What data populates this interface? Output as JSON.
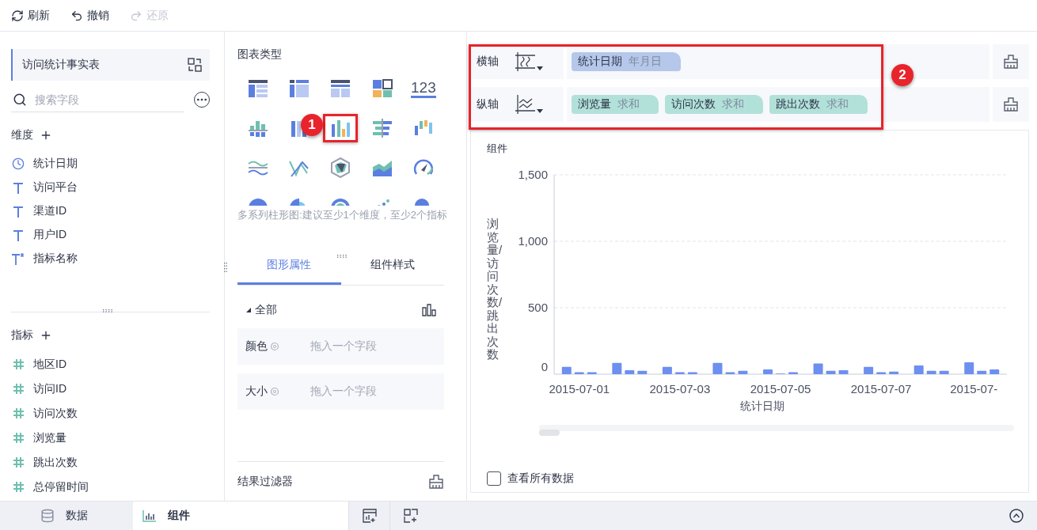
{
  "toolbar": {
    "buttons": [
      {
        "kind": "refresh",
        "label": "刷新",
        "disabled": false
      },
      {
        "kind": "undo",
        "label": "撤销",
        "disabled": false
      },
      {
        "kind": "redo",
        "label": "还原",
        "disabled": true
      }
    ]
  },
  "data_panel": {
    "table_name": "访问统计事实表",
    "search": {
      "placeholder": "搜索字段"
    },
    "dimensions": {
      "title": "维度",
      "fields": [
        {
          "kind": "date",
          "name": "统计日期"
        },
        {
          "kind": "text",
          "name": "访问平台"
        },
        {
          "kind": "text",
          "name": "渠道ID"
        },
        {
          "kind": "text",
          "name": "用户ID"
        },
        {
          "kind": "calc-text",
          "name": "指标名称"
        }
      ]
    },
    "measures": {
      "title": "指标",
      "fields": [
        {
          "kind": "number",
          "name": "地区ID"
        },
        {
          "kind": "number",
          "name": "访问ID"
        },
        {
          "kind": "number",
          "name": "访问次数"
        },
        {
          "kind": "number",
          "name": "浏览量"
        },
        {
          "kind": "number",
          "name": "跳出次数"
        },
        {
          "kind": "number",
          "name": "总停留时间"
        }
      ]
    }
  },
  "chart_types": {
    "title": "图表类型",
    "items": [
      {
        "kind": "table",
        "selected": false
      },
      {
        "kind": "crosstab",
        "selected": false
      },
      {
        "kind": "detail",
        "selected": false
      },
      {
        "kind": "tiles",
        "selected": false
      },
      {
        "kind": "kpi",
        "label": "123",
        "selected": false
      },
      {
        "kind": "stacked-bar",
        "selected": false
      },
      {
        "kind": "percent-bar",
        "selected": false
      },
      {
        "kind": "multi-bar",
        "selected": true
      },
      {
        "kind": "diverging-bar",
        "selected": false
      },
      {
        "kind": "range-bar",
        "selected": false
      },
      {
        "kind": "wave",
        "selected": false
      },
      {
        "kind": "line",
        "selected": false
      },
      {
        "kind": "radar",
        "selected": false
      },
      {
        "kind": "area",
        "selected": false
      },
      {
        "kind": "gauge",
        "selected": false
      },
      {
        "kind": "pie",
        "selected": false
      },
      {
        "kind": "rose",
        "selected": false
      },
      {
        "kind": "sunburst",
        "selected": false
      },
      {
        "kind": "scatter",
        "selected": false
      },
      {
        "kind": "bubble",
        "selected": false
      }
    ],
    "hint": "多系列柱形图:建议至少1个维度，至少2个指标"
  },
  "property_tabs": [
    {
      "label": "图形属性",
      "selected": true
    },
    {
      "label": "组件样式",
      "selected": false
    }
  ],
  "properties": {
    "group": "全部",
    "expanded": true,
    "rows": [
      {
        "label": "颜色",
        "placeholder": "拖入一个字段"
      },
      {
        "label": "大小",
        "placeholder": "拖入一个字段"
      }
    ]
  },
  "result_filter": {
    "title": "结果过滤器"
  },
  "axes": [
    {
      "label": "横轴",
      "kind": "x",
      "chips": [
        {
          "kind": "dimension",
          "field": "统计日期",
          "agg": "年月日"
        }
      ]
    },
    {
      "label": "纵轴",
      "kind": "y",
      "chips": [
        {
          "kind": "measure",
          "field": "浏览量",
          "agg": "求和"
        },
        {
          "kind": "measure",
          "field": "访问次数",
          "agg": "求和"
        },
        {
          "kind": "measure",
          "field": "跳出次数",
          "agg": "求和"
        }
      ]
    }
  ],
  "chart": {
    "title": "组件",
    "chart_data": {
      "type": "bar",
      "xlabel": "统计日期",
      "ylabel": "浏览量/访问次数/跳出次数",
      "categories": [
        "2015-07-01",
        null,
        "2015-07-03",
        null,
        "2015-07-05",
        null,
        "2015-07-07",
        null,
        "2015-07-"
      ],
      "series": [
        {
          "color": "#6d8ff0",
          "values": [
            55,
            85,
            55,
            85,
            35,
            80,
            55,
            65,
            90
          ]
        },
        {
          "color": "#6d8ff0",
          "values": [
            15,
            30,
            15,
            15,
            5,
            25,
            15,
            25,
            25
          ]
        },
        {
          "color": "#6d8ff0",
          "values": [
            15,
            25,
            15,
            25,
            15,
            30,
            20,
            25,
            35
          ]
        }
      ],
      "ylim": [
        0,
        1500
      ],
      "yticks": [
        {
          "value": 0,
          "label": "0"
        },
        {
          "value": 500,
          "label": "500"
        },
        {
          "value": 1000,
          "label": "1,000"
        },
        {
          "value": 1500,
          "label": "1,500"
        }
      ],
      "stacked": false
    },
    "show_all": {
      "label": "查看所有数据",
      "checked": false
    }
  },
  "bottom_tabs": [
    {
      "kind": "data",
      "label": "数据",
      "selected": false
    },
    {
      "kind": "component",
      "label": "组件",
      "selected": true
    }
  ],
  "callouts": [
    {
      "label": "1"
    },
    {
      "label": "2"
    }
  ]
}
